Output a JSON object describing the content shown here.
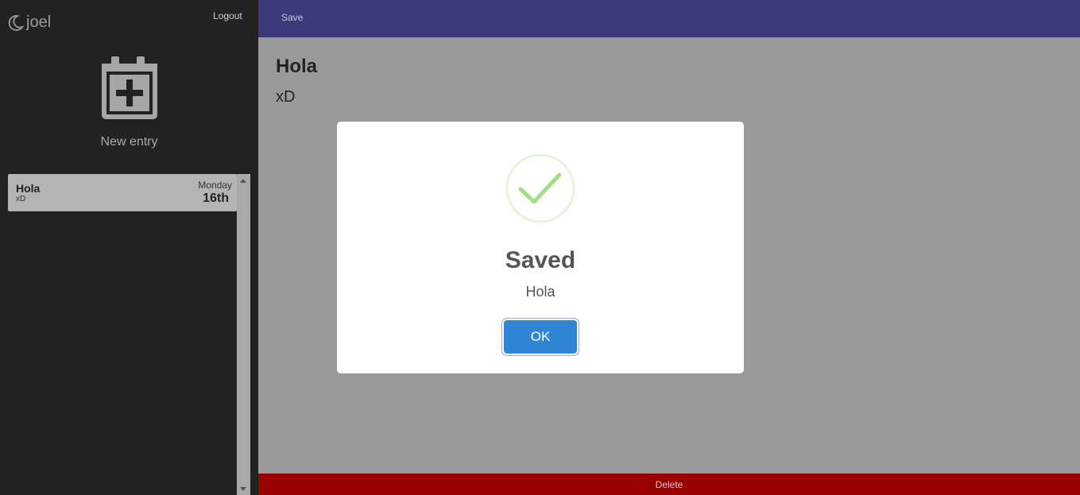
{
  "sidebar": {
    "brand_icon": "moon-icon",
    "brand_name": "joel",
    "logout_label": "Logout",
    "new_entry_icon": "calendar-plus-icon",
    "new_entry_label": "New entry",
    "entries": [
      {
        "title": "Hola",
        "preview": "xD",
        "day": "Monday",
        "date": "16th"
      }
    ]
  },
  "toolbar": {
    "save_label": "Save",
    "color": "#3b3a7a"
  },
  "document": {
    "title": "Hola",
    "body": "xD"
  },
  "footer": {
    "delete_label": "Delete",
    "color": "#990000"
  },
  "modal": {
    "icon": "success-check-icon",
    "title": "Saved",
    "text": "Hola",
    "ok_label": "OK",
    "button_color": "#3085d6"
  }
}
